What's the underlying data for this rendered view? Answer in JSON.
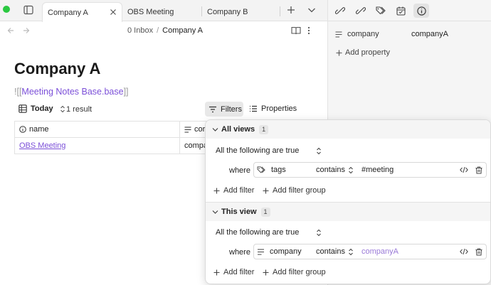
{
  "tabs": [
    {
      "label": "Company A",
      "active": true
    },
    {
      "label": "OBS Meeting",
      "active": false
    },
    {
      "label": "Company B",
      "active": false
    }
  ],
  "breadcrumb": {
    "folder": "0 Inbox",
    "separator": "/",
    "current": "Company A"
  },
  "page": {
    "title": "Company A",
    "embed_open": "![[",
    "embed_link": "Meeting Notes Base.base",
    "embed_close": "]]"
  },
  "base_toolbar": {
    "view_label": "Today",
    "result_count": "1 result",
    "filters_label": "Filters",
    "properties_label": "Properties"
  },
  "table": {
    "columns": [
      "name",
      "cor"
    ],
    "rows": [
      [
        "OBS Meeting",
        "compa"
      ]
    ]
  },
  "filters": {
    "all_views": {
      "title": "All views",
      "count": "1",
      "conjunction": "All the following are true",
      "where": "where",
      "property": "tags",
      "operator": "contains",
      "value": "#meeting",
      "add_filter": "Add filter",
      "add_group": "Add filter group"
    },
    "this_view": {
      "title": "This view",
      "count": "1",
      "conjunction": "All the following are true",
      "where": "where",
      "property": "company",
      "operator": "contains",
      "value": "companyA",
      "add_filter": "Add filter",
      "add_group": "Add filter group"
    }
  },
  "properties_panel": {
    "property_key": "company",
    "property_value": "companyA",
    "add_property": "Add property"
  },
  "colors": {
    "accent": "#7b4fd8",
    "status_dot": "#2ac840"
  }
}
